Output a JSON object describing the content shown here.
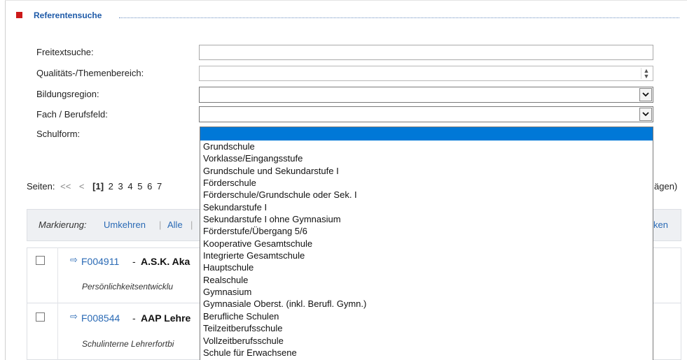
{
  "section": {
    "title": "Referentensuche"
  },
  "form": {
    "freitext_label": "Freitextsuche:",
    "freitext_value": "",
    "qualitaet_label": "Qualitäts-/Themenbereich:",
    "region_label": "Bildungsregion:",
    "fach_label": "Fach / Berufsfeld:",
    "schulform_label": "Schulform:"
  },
  "pager": {
    "label": "Seiten:",
    "first": "<<",
    "prev": "<",
    "current": "[1]",
    "pages": [
      "2",
      "3",
      "4",
      "5",
      "6",
      "7"
    ],
    "right_text": "ägen)"
  },
  "markbar": {
    "label": "Markierung:",
    "invert": "Umkehren",
    "sep": "|",
    "all": "Alle",
    "right_text": "ken"
  },
  "results": [
    {
      "id": "F004911",
      "dash": "-",
      "title": "A.S.K. Aka",
      "subtitle": "Persönlichkeitsentwicklu"
    },
    {
      "id": "F008544",
      "dash": "-",
      "title": "AAP Lehre",
      "subtitle": "Schulinterne Lehrerfortbi"
    }
  ],
  "schulform_options": [
    "",
    "Grundschule",
    "Vorklasse/Eingangsstufe",
    "Grundschule und Sekundarstufe I",
    "Förderschule",
    "Förderschule/Grundschule oder Sek. I",
    "Sekundarstufe I",
    "Sekundarstufe I ohne Gymnasium",
    "Förderstufe/Übergang 5/6",
    "Kooperative Gesamtschule",
    "Integrierte Gesamtschule",
    "Hauptschule",
    "Realschule",
    "Gymnasium",
    "Gymnasiale Oberst. (inkl. Berufl. Gymn.)",
    "Berufliche Schulen",
    "Teilzeitberufsschule",
    "Vollzeitberufsschule",
    "Schule für Erwachsene"
  ],
  "icons": {
    "section_marker": "red-square-icon",
    "result_link": "arrow-right-box-icon",
    "select": "chevron-down-icon",
    "spinner": "up-down-spinner-icon"
  },
  "colors": {
    "accent_red": "#cc1a1a",
    "link_blue": "#2a6ab5",
    "title_blue": "#1e5aa8",
    "selection_blue": "#0078d7"
  }
}
